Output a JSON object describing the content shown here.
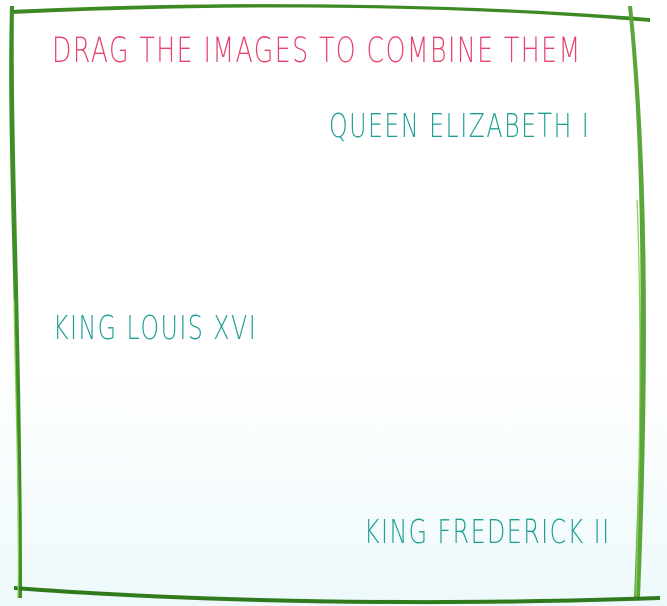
{
  "instruction": "DRAG THE IMAGES TO COMBINE THEM",
  "items": [
    {
      "label": "QUEEN ELIZABETH I"
    },
    {
      "label": "KING LOUIS XVI"
    },
    {
      "label": "KING FREDERICK II"
    }
  ],
  "colors": {
    "instruction": "#e8416b",
    "label": "#1f9e94",
    "frame_dark": "#2e7a1f",
    "frame_light": "#7ec44a"
  }
}
